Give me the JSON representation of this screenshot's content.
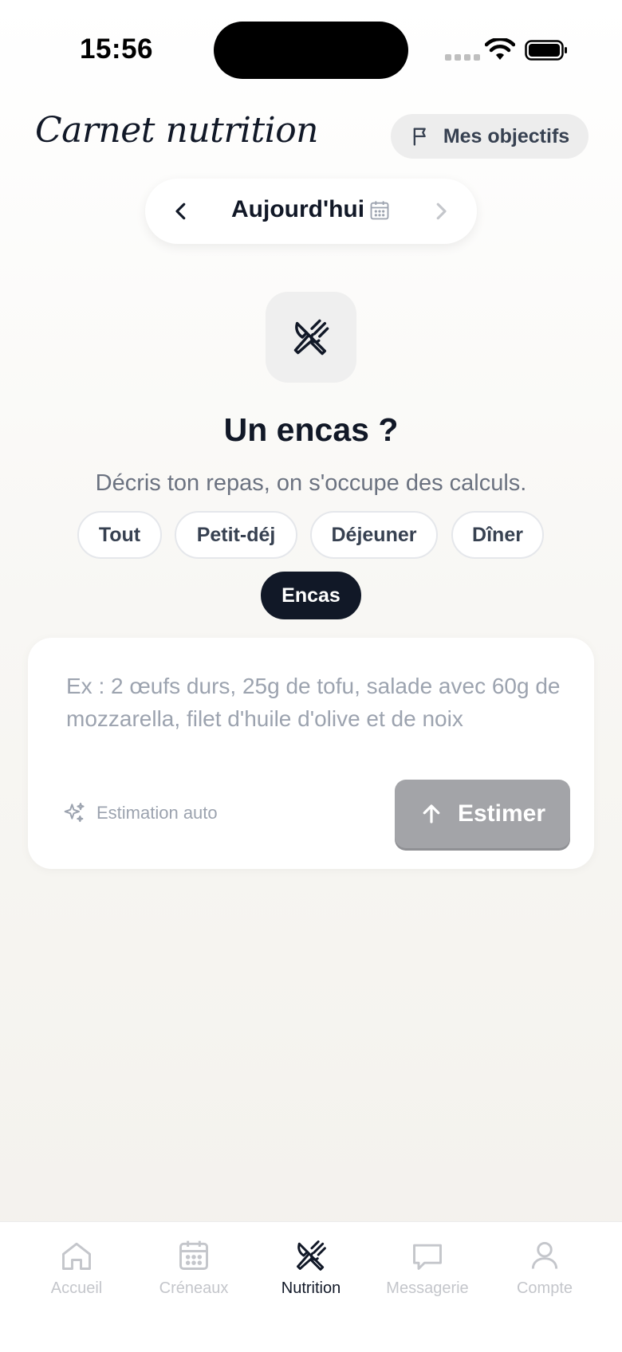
{
  "status_bar": {
    "time": "15:56"
  },
  "header": {
    "title": "Carnet nutrition",
    "goals_label": "Mes objectifs"
  },
  "date_nav": {
    "label": "Aujourd'hui"
  },
  "empty_state": {
    "heading": "Un encas ?",
    "subtext": "Décris ton repas, on s'occupe des calculs."
  },
  "filters": {
    "items": [
      {
        "label": "Tout",
        "active": false
      },
      {
        "label": "Petit-déj",
        "active": false
      },
      {
        "label": "Déjeuner",
        "active": false
      },
      {
        "label": "Dîner",
        "active": false
      },
      {
        "label": "Encas",
        "active": true
      }
    ]
  },
  "meal_input": {
    "value": "",
    "placeholder": "Ex : 2 œufs durs, 25g de tofu, salade avec 60g de mozzarella, filet d'huile d'olive et de noix",
    "auto_label": "Estimation auto",
    "submit_label": "Estimer"
  },
  "tabbar": {
    "items": [
      {
        "label": "Accueil",
        "icon": "home-icon",
        "active": false
      },
      {
        "label": "Créneaux",
        "icon": "calendar-icon",
        "active": false
      },
      {
        "label": "Nutrition",
        "icon": "utensils-icon",
        "active": true
      },
      {
        "label": "Messagerie",
        "icon": "message-icon",
        "active": false
      },
      {
        "label": "Compte",
        "icon": "user-icon",
        "active": false
      }
    ]
  },
  "colors": {
    "primary": "#111827",
    "muted": "#6b7280",
    "disabled_button": "#a3a4a8",
    "chip_border": "#e5e7eb"
  }
}
